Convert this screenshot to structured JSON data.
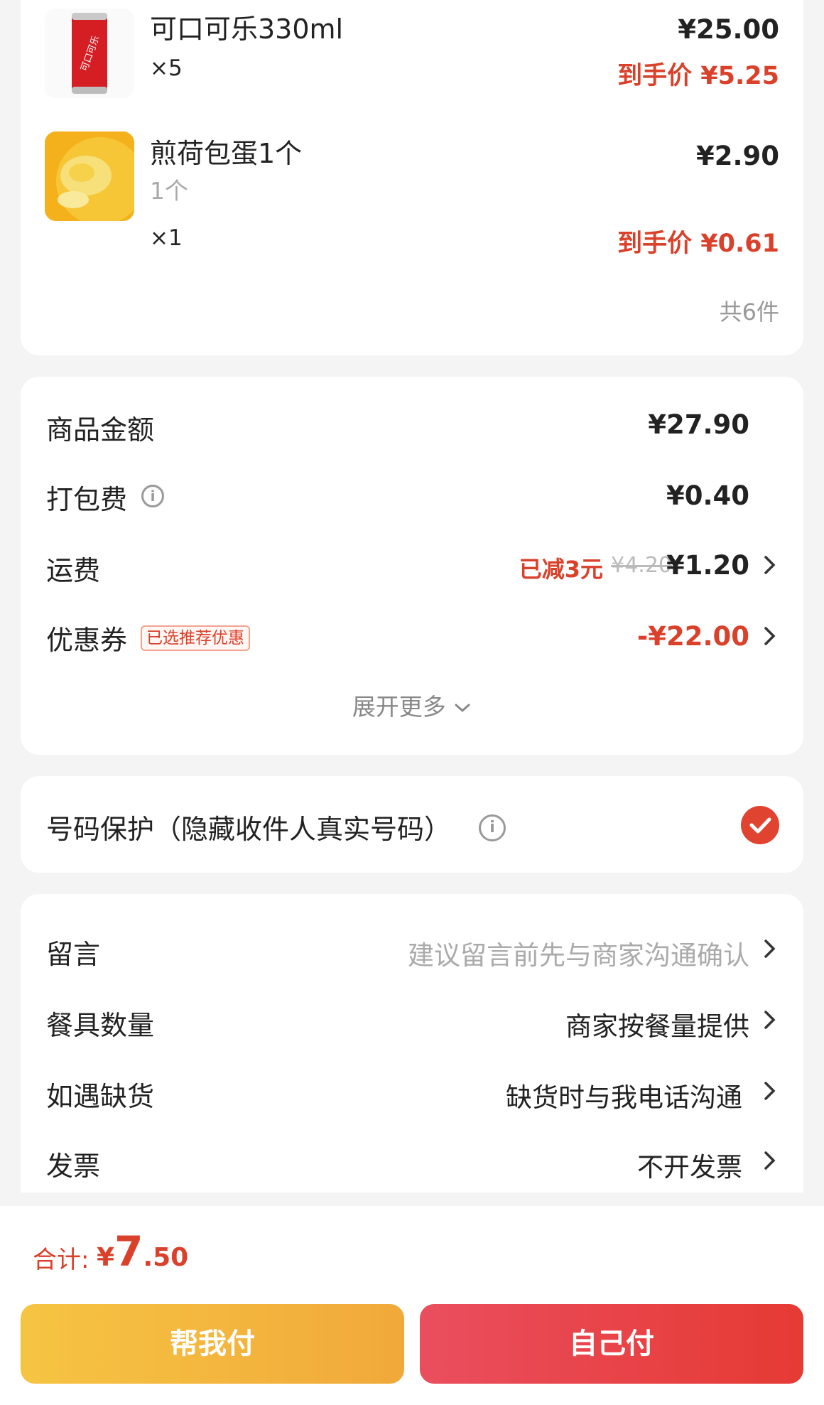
{
  "items": [
    {
      "name": "可口可乐330ml",
      "spec": "",
      "qty": "×5",
      "price": "¥25.00",
      "final_price": "到手价 ¥5.25",
      "thumb": "coca-cola-can"
    },
    {
      "name": "煎荷包蛋1个",
      "spec": "1个",
      "qty": "×1",
      "price": "¥2.90",
      "final_price": "到手价 ¥0.61",
      "thumb": "fried-egg"
    }
  ],
  "thumb_text": {
    "coke_logo": "可口可乐"
  },
  "item_count": "共6件",
  "fees": {
    "goods_label": "商品金额",
    "goods_value": "¥27.90",
    "packing_label": "打包费",
    "packing_value": "¥0.40",
    "delivery_label": "运费",
    "delivery_reduced": "已减3元",
    "delivery_original": "¥4.20",
    "delivery_value": "¥1.20",
    "coupon_label": "优惠券",
    "coupon_tag": "已选推荐优惠",
    "coupon_value": "-¥22.00",
    "expand": "展开更多"
  },
  "privacy": {
    "label": "号码保护（隐藏收件人真实号码）",
    "checked": true
  },
  "extra": {
    "note_label": "留言",
    "note_placeholder": "建议留言前先与商家沟通确认",
    "utensils_label": "餐具数量",
    "utensils_value": "商家按餐量提供",
    "stockout_label": "如遇缺货",
    "stockout_value": "缺货时与我电话沟通",
    "invoice_label": "发票",
    "invoice_value": "不开发票"
  },
  "bottom": {
    "total_label": "合计:",
    "total_symbol": "¥",
    "total_int": "7",
    "total_dec": ".50",
    "help_pay": "帮我付",
    "self_pay": "自己付"
  },
  "colors": {
    "accent_red": "#d9412b",
    "help_gradient": [
      "#f6c443",
      "#f1a93a"
    ],
    "self_gradient": [
      "#ea4e5e",
      "#e63a34"
    ]
  },
  "icons": [
    "info-icon",
    "chevron-right-icon",
    "chevron-down-icon",
    "check-icon"
  ]
}
